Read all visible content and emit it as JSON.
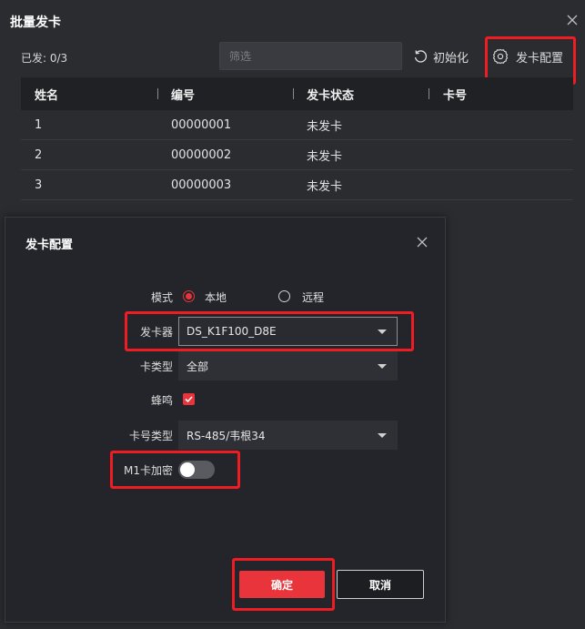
{
  "outer": {
    "title": "批量发卡",
    "sent_label": "已发: 0/3",
    "filter_placeholder": "筛选",
    "init_label": "初始化",
    "config_label": "发卡配置"
  },
  "table": {
    "headers": [
      "姓名",
      "编号",
      "发卡状态",
      "卡号"
    ],
    "rows": [
      {
        "name": "1",
        "id": "00000001",
        "status": "未发卡",
        "card": ""
      },
      {
        "name": "2",
        "id": "00000002",
        "status": "未发卡",
        "card": ""
      },
      {
        "name": "3",
        "id": "00000003",
        "status": "未发卡",
        "card": ""
      }
    ]
  },
  "modal": {
    "title": "发卡配置",
    "mode_label": "模式",
    "mode_options": [
      "本地",
      "远程"
    ],
    "mode_selected": "本地",
    "issuer_label": "发卡器",
    "issuer_value": "DS_K1F100_D8E",
    "card_type_label": "卡类型",
    "card_type_value": "全部",
    "buzzer_label": "蜂鸣",
    "buzzer_checked": true,
    "card_no_type_label": "卡号类型",
    "card_no_type_value": "RS-485/韦根34",
    "m1_label": "M1卡加密",
    "m1_enabled": false,
    "ok_label": "确定",
    "cancel_label": "取消"
  },
  "colors": {
    "accent": "#e8343a",
    "highlight": "#ee1d24",
    "background": "#2b2c30"
  }
}
